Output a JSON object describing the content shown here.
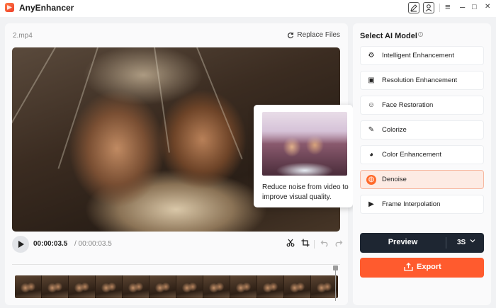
{
  "app": {
    "title": "AnyEnhancer"
  },
  "window_controls": {
    "menu": "≡",
    "minimize": "–",
    "maximize": "□",
    "close": "✕"
  },
  "player": {
    "filename": "2.mp4",
    "replace_label": "Replace Files",
    "current_time": "00:00:03.5",
    "total_time": "/ 00:00:03.5"
  },
  "popup": {
    "description": "Reduce noise from video to improve visual quality."
  },
  "panel": {
    "title": "Select AI Model",
    "models": [
      {
        "label": "Intelligent Enhancement",
        "icon": "robot-icon",
        "glyph": "⚙"
      },
      {
        "label": "Resolution Enhancement",
        "icon": "resolution-icon",
        "glyph": "▣"
      },
      {
        "label": "Face Restoration",
        "icon": "face-icon",
        "glyph": "☺"
      },
      {
        "label": "Colorize",
        "icon": "colorize-icon",
        "glyph": "✎"
      },
      {
        "label": "Color Enhancement",
        "icon": "palette-icon",
        "glyph": "◕"
      },
      {
        "label": "Denoise",
        "icon": "denoise-icon",
        "glyph": "◍",
        "selected": true
      },
      {
        "label": "Frame Interpolation",
        "icon": "frame-interpolation-icon",
        "glyph": "▶"
      }
    ],
    "preview_label": "Preview",
    "preview_duration": "3S",
    "export_label": "Export"
  },
  "colors": {
    "accent": "#ff5b2e",
    "selected_bg": "#fdebe4",
    "dark_button": "#1e2632"
  }
}
